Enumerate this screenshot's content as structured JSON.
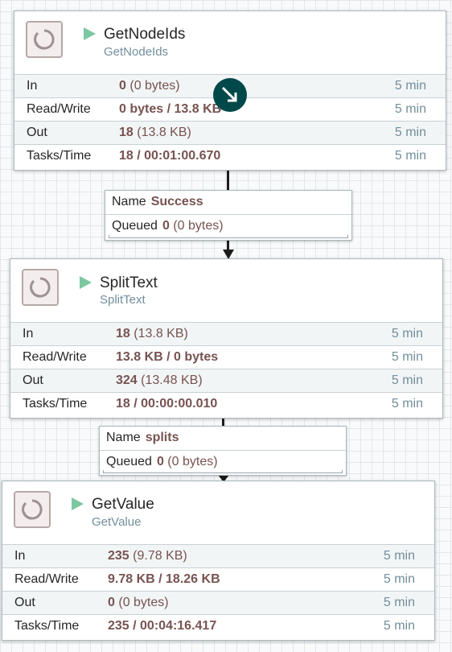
{
  "processors": [
    {
      "name": "GetNodeIds",
      "type": "GetNodeIds",
      "rows": [
        {
          "label": "In",
          "value": "0",
          "detail": "(0 bytes)",
          "time": "5 min"
        },
        {
          "label": "Read/Write",
          "value": "0 bytes / 13.8 KB",
          "detail": "",
          "time": "5 min"
        },
        {
          "label": "Out",
          "value": "18",
          "detail": "(13.8 KB)",
          "time": "5 min"
        },
        {
          "label": "Tasks/Time",
          "value": "18 / 00:01:00.670",
          "detail": "",
          "time": "5 min"
        }
      ]
    },
    {
      "name": "SplitText",
      "type": "SplitText",
      "rows": [
        {
          "label": "In",
          "value": "18",
          "detail": "(13.8 KB)",
          "time": "5 min"
        },
        {
          "label": "Read/Write",
          "value": "13.8 KB / 0 bytes",
          "detail": "",
          "time": "5 min"
        },
        {
          "label": "Out",
          "value": "324",
          "detail": "(13.48 KB)",
          "time": "5 min"
        },
        {
          "label": "Tasks/Time",
          "value": "18 / 00:00:00.010",
          "detail": "",
          "time": "5 min"
        }
      ]
    },
    {
      "name": "GetValue",
      "type": "GetValue",
      "rows": [
        {
          "label": "In",
          "value": "235",
          "detail": "(9.78 KB)",
          "time": "5 min"
        },
        {
          "label": "Read/Write",
          "value": "9.78 KB / 18.26 KB",
          "detail": "",
          "time": "5 min"
        },
        {
          "label": "Out",
          "value": "0",
          "detail": "(0 bytes)",
          "time": "5 min"
        },
        {
          "label": "Tasks/Time",
          "value": "235 / 00:04:16.417",
          "detail": "",
          "time": "5 min"
        }
      ]
    }
  ],
  "connections": [
    {
      "name_label": "Name",
      "name_value": "Success",
      "queued_label": "Queued",
      "queued_value": "0",
      "queued_detail": "(0 bytes)"
    },
    {
      "name_label": "Name",
      "name_value": "splits",
      "queued_label": "Queued",
      "queued_value": "0",
      "queued_detail": "(0 bytes)"
    }
  ],
  "colors": {
    "run": "#7dc7a0",
    "value": "#775351",
    "time": "#728e9b",
    "badge": "#004849"
  },
  "icons": {
    "processor": "processor-icon",
    "run": "play-icon",
    "badge": "expand-arrow-icon"
  }
}
